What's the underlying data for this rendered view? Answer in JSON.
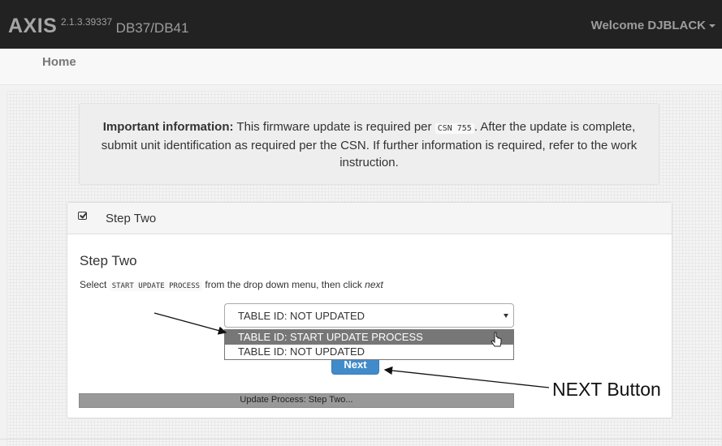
{
  "navbar": {
    "brand": "AXIS",
    "version": "2.1.3.39337",
    "db": "DB37/DB41",
    "welcome": "Welcome DJBLACK"
  },
  "subnav": {
    "home": "Home"
  },
  "info": {
    "strong": "Important information:",
    "text1": " This firmware update is required per ",
    "code": "CSN 755",
    "text2": ". After the update is complete, submit unit identification as required per the CSN. If further information is required, refer to the work instruction."
  },
  "panel": {
    "heading": "Step Two",
    "title": "Step Two",
    "instr_prefix": "Select ",
    "instr_code": "START UPDATE PROCESS",
    "instr_middle": " from the drop down menu, then click ",
    "instr_em": "next"
  },
  "select": {
    "value": "TABLE ID: NOT UPDATED",
    "options": [
      "TABLE ID: START UPDATE PROCESS",
      "TABLE ID: NOT UPDATED"
    ],
    "highlighted": "TABLE ID: START UPDATE PROCESS"
  },
  "buttons": {
    "next": "Next"
  },
  "progress": {
    "label": "Update Process: Step Two...",
    "value_percent": 100
  },
  "annotation": {
    "next_label": "NEXT Button"
  },
  "colors": {
    "navbar": "#222222",
    "primary": "#428bca",
    "highlight": "#777777",
    "progress": "#999999"
  },
  "icons": {
    "heading": "check-square-icon",
    "cursor": "pointer-cursor-icon",
    "select": "caret-down-icon"
  }
}
